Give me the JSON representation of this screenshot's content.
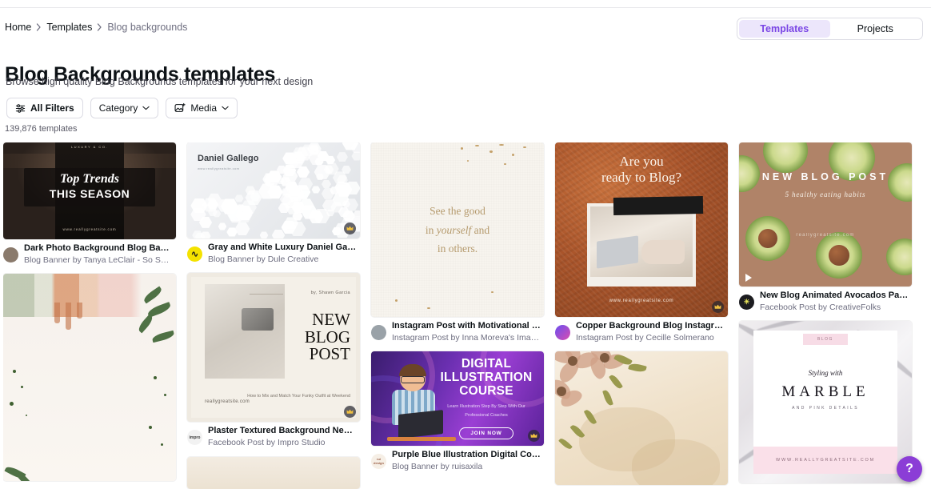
{
  "breadcrumb": {
    "items": [
      {
        "label": "Home"
      },
      {
        "label": "Templates"
      },
      {
        "label": "Blog backgrounds"
      }
    ]
  },
  "tabs": {
    "templates": "Templates",
    "projects": "Projects",
    "active": "Templates"
  },
  "header": {
    "title": "Blog Backgrounds templates",
    "subtitle": "Browse high quality Blog Backgrounds templates for your next design",
    "result_count": "139,876 templates"
  },
  "filters": [
    {
      "label": "All Filters",
      "icon": "sliders-icon",
      "has_chevron": false
    },
    {
      "label": "Category",
      "icon": "",
      "has_chevron": true
    },
    {
      "label": "Media",
      "icon": "media-image-icon",
      "has_chevron": true
    }
  ],
  "colors": {
    "accent": "#7a45e5",
    "accent_pill": "#ece6fb",
    "fab": "#8b3dd6",
    "text": "#0d1216",
    "muted": "#6e6e80"
  },
  "cards": [
    {
      "title": "Dark Photo Background Blog Banner",
      "byline": "Blog Banner by Tanya LeClair - So Swell Studio",
      "art": {
        "line1": "Top Trends",
        "line2": "THIS SEASON",
        "url": "www.reallygreatsite.com",
        "topmark": "LUXURY & CO."
      },
      "pro": false,
      "video": false
    },
    {
      "title": "Gray and White Luxury Daniel Gallego ...",
      "byline": "Blog Banner by Dule Creative",
      "art": {
        "name": "Daniel Gallego",
        "url": "www.reallygreatsite.com"
      },
      "pro": true,
      "video": false
    },
    {
      "title": "",
      "byline": "",
      "art": {},
      "pro": false,
      "video": false
    },
    {
      "title": "Instagram Post with Motivational Quo...",
      "byline": "Instagram Post by Inna Moreva's Images",
      "art": {
        "line1": "See the good",
        "line2a": "in ",
        "line2i": "yourself",
        "line2b": " and",
        "line3": "in others."
      },
      "pro": false,
      "video": false
    },
    {
      "title": "Copper Background Blog Instagram P...",
      "byline": "Instagram Post by Cecille Solmerano",
      "art": {
        "line1": "Are you",
        "line2": "ready to Blog?",
        "url": "www.reallygreatsite.com"
      },
      "pro": true,
      "video": false
    },
    {
      "title": "New Blog Animated Avocados Pattern ...",
      "byline": "Facebook Post by CreativeFolks",
      "art": {
        "line1": "NEW BLOG POST",
        "line2": "5 healthy eating habits",
        "url": "reallygreatsite.com"
      },
      "pro": false,
      "video": true
    },
    {
      "title": "Plaster Textured Background New Blo...",
      "byline": "Facebook Post by Impro Studio",
      "art": {
        "by": "by, Shawn Garcia",
        "l1": "NEW",
        "l2": "BLOG",
        "l3": "POST",
        "small": "How to Mix and Match Your Funky Outfit at Weekend",
        "url": "reallygreatsite.com"
      },
      "pro": true,
      "video": false
    },
    {
      "title": "Purple Blue Illustration Digital Course...",
      "byline": "Blog Banner by ruisaxila",
      "art": {
        "l1": "DIGITAL",
        "l2": "ILLUSTRATION",
        "l3": "COURSE",
        "sub": "Learn Illustration Step By Step With Our Professional Coaches",
        "btn": "JOIN NOW"
      },
      "pro": true,
      "video": false
    },
    {
      "title": "",
      "byline": "",
      "art": {},
      "pro": false,
      "video": false
    },
    {
      "title": "",
      "byline": "",
      "art": {
        "tag": "BLOG",
        "script": "Styling with",
        "big": "MARBLE",
        "sub": "AND PINK DETAILS",
        "url": "WWW.REALLYGREATSITE.COM"
      },
      "pro": false,
      "video": false
    }
  ],
  "avatars": [
    {
      "name": "tanya-leclair-avatar",
      "bg": "#8a7a6c",
      "initials": ""
    },
    {
      "name": "dule-creative-avatar",
      "bg": "#f4e200",
      "initials": "s"
    },
    {
      "name": "inna-moreva-avatar",
      "bg": "#9aa2a8",
      "initials": ""
    },
    {
      "name": "cecille-solmerano-avatar",
      "bg": "#6a4df0",
      "initials": ""
    },
    {
      "name": "creativefolks-avatar",
      "bg": "#1c1c20",
      "initials": ""
    },
    {
      "name": "impro-studio-avatar",
      "bg": "#f2f2f2",
      "initials": "impro"
    },
    {
      "name": "ruisaxila-avatar",
      "bg": "#f6efe6",
      "initials": "rs"
    }
  ],
  "help": {
    "label": "?"
  }
}
